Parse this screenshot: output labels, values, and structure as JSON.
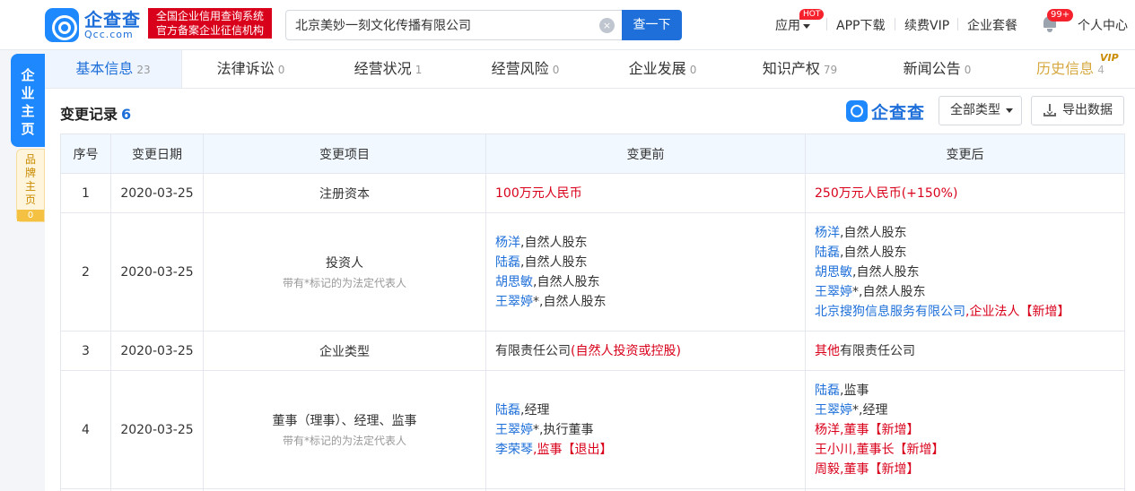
{
  "header": {
    "logo_cn": "企查查",
    "logo_en": "Qcc.com",
    "cred_line1": "全国企业信用查询系统",
    "cred_line2": "官方备案企业征信机构",
    "search_value": "北京美妙一刻文化传播有限公司",
    "search_clear": "×",
    "search_button": "查一下",
    "nav_apps": "应用",
    "hot_badge": "HOT",
    "nav_app_download": "APP下载",
    "nav_vip": "续费VIP",
    "nav_package": "企业套餐",
    "msg_badge": "99+",
    "nav_user": "个人中心"
  },
  "side": {
    "main_lines": [
      "企",
      "业",
      "主",
      "页"
    ],
    "brand_lines": [
      "品",
      "牌",
      "主",
      "页"
    ],
    "brand_count": "0"
  },
  "tabs": [
    {
      "label": "基本信息",
      "count": "23"
    },
    {
      "label": "法律诉讼",
      "count": "0"
    },
    {
      "label": "经营状况",
      "count": "1"
    },
    {
      "label": "经营风险",
      "count": "0"
    },
    {
      "label": "企业发展",
      "count": "0"
    },
    {
      "label": "知识产权",
      "count": "79"
    },
    {
      "label": "新闻公告",
      "count": "0"
    },
    {
      "label": "历史信息",
      "count": "4"
    }
  ],
  "vip_mark": "VIP",
  "section": {
    "title": "变更记录",
    "count": "6",
    "watermark": "企查查",
    "filter_label": "全部类型",
    "export_label": "导出数据"
  },
  "table": {
    "headers": [
      "序号",
      "变更日期",
      "变更项目",
      "变更前",
      "变更后"
    ],
    "note": "带有*标记的为法定代表人",
    "rows": [
      {
        "no": "1",
        "date": "2020-03-25",
        "item": "注册资本",
        "before": "100万元人民币",
        "after": "250万元人民币(+150%)"
      },
      {
        "no": "2",
        "date": "2020-03-25",
        "item": "投资人",
        "before": [
          {
            "name": "杨洋",
            "role": ",自然人股东"
          },
          {
            "name": "陆磊",
            "role": ",自然人股东"
          },
          {
            "name": "胡思敏",
            "role": ",自然人股东"
          },
          {
            "name": "王翠婷",
            "role": "*,自然人股东"
          }
        ],
        "after": [
          {
            "name": "杨洋",
            "role": ",自然人股东",
            "tag": ""
          },
          {
            "name": "陆磊",
            "role": ",自然人股东",
            "tag": ""
          },
          {
            "name": "胡思敏",
            "role": ",自然人股东",
            "tag": ""
          },
          {
            "name": "王翠婷",
            "role": "*,自然人股东",
            "tag": ""
          },
          {
            "name": "北京搜狗信息服务有限公司",
            "role": ",企业法人【新增】",
            "tag": "new"
          }
        ]
      },
      {
        "no": "3",
        "date": "2020-03-25",
        "item": "企业类型",
        "before_main": "有限责任公司",
        "before_mark": "(自然人投资或控股)",
        "after_mark": "其他",
        "after_main": "有限责任公司"
      },
      {
        "no": "4",
        "date": "2020-03-25",
        "item": "董事（理事）、经理、监事",
        "before": [
          {
            "name": "陆磊",
            "role": ",经理"
          },
          {
            "name": "王翠婷",
            "role": "*,执行董事"
          },
          {
            "name": "李荣琴",
            "role": ",监事【退出】"
          }
        ],
        "after": [
          {
            "name": "陆磊",
            "role": ",监事"
          },
          {
            "name": "王翠婷",
            "role": "*,经理"
          },
          {
            "name": "杨洋",
            "role": ",董事【新增】"
          },
          {
            "name": "王小川",
            "role": ",董事长【新增】"
          },
          {
            "name": "周毅",
            "role": ",董事【新增】"
          }
        ]
      }
    ]
  }
}
